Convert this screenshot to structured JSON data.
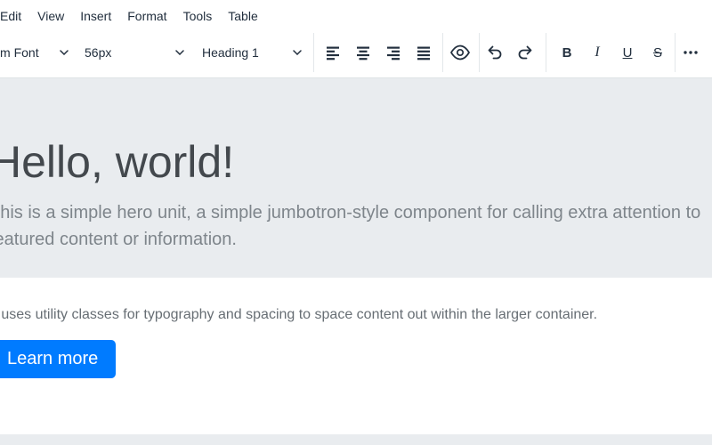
{
  "menu": {
    "items": [
      "Edit",
      "View",
      "Insert",
      "Format",
      "Tools",
      "Table"
    ]
  },
  "toolbar": {
    "font_family": "System Font",
    "font_size": "56px",
    "block_format": "Heading 1",
    "format_buttons": {
      "bold": "B",
      "italic": "I",
      "underline": "U",
      "strikethrough": "S"
    },
    "icons": {
      "dropdown": "chevron-down",
      "align": [
        "align-left",
        "align-center",
        "align-right",
        "align-justify"
      ],
      "preview": "eye",
      "undo": "undo-arrow",
      "redo": "redo-arrow",
      "overflow": "ellipsis"
    }
  },
  "content": {
    "heading": "Hello, world!",
    "lead_lines": [
      "This is a simple hero unit, a simple jumbotron-style component for calling extra attention to",
      "featured content or information."
    ],
    "body_text": "It uses utility classes for typography and spacing to space content out within the larger container.",
    "cta_label": "Learn more"
  },
  "colors": {
    "primary": "#007bff",
    "jumbotron_bg": "#e9ecef",
    "toolbar_icon": "#222f3e"
  }
}
